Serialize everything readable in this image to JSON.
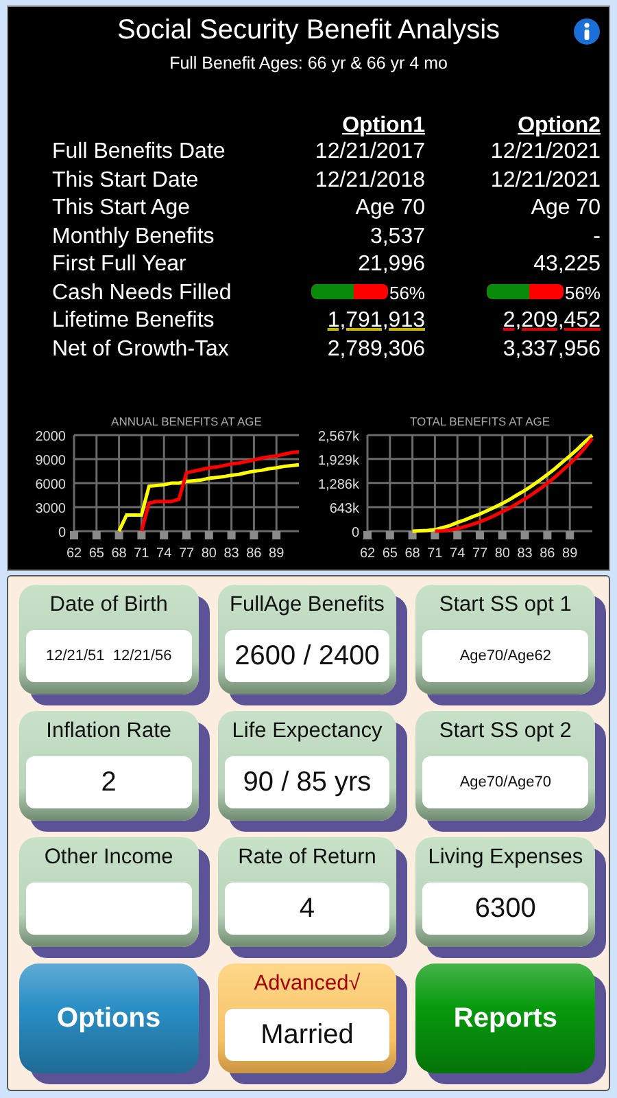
{
  "header": {
    "title": "Social Security Benefit Analysis",
    "subtitle": "Full Benefit Ages: 66 yr & 66 yr 4 mo"
  },
  "table": {
    "columns": [
      {
        "label": "Option1",
        "color": "#c8b400"
      },
      {
        "label": "Option2",
        "color": "#e00000"
      }
    ],
    "rows": [
      {
        "kind": "text",
        "label": "Full Benefits Date",
        "values": [
          "12/21/2017",
          "12/21/2021"
        ]
      },
      {
        "kind": "text",
        "label": "This Start Date",
        "values": [
          "12/21/2018",
          "12/21/2021"
        ]
      },
      {
        "kind": "text",
        "label": "This Start Age",
        "values": [
          "Age 70",
          "Age 70"
        ]
      },
      {
        "kind": "text",
        "label": "Monthly Benefits",
        "values": [
          "3,537",
          "-"
        ]
      },
      {
        "kind": "text",
        "label": "First Full Year",
        "values": [
          "21,996",
          "43,225"
        ]
      },
      {
        "kind": "meter",
        "label": "Cash Needs Filled",
        "cells": [
          {
            "level": 0.56,
            "reading": "56%"
          },
          {
            "level": 0.56,
            "reading": "56%"
          }
        ]
      },
      {
        "kind": "underlined",
        "label": "Lifetime Benefits",
        "values": [
          "1,791,913",
          "2,209,452"
        ]
      },
      {
        "kind": "text",
        "label": "Net of Growth-Tax",
        "values": [
          "2,789,306",
          "3,337,956"
        ]
      }
    ]
  },
  "charts": [
    {
      "chart_data": {
        "type": "line",
        "title": "ANNUAL BENEFITS AT AGE",
        "x": [
          68,
          69,
          70,
          71,
          72,
          73,
          74,
          75,
          76,
          77,
          78,
          79,
          80,
          81,
          82,
          83,
          84,
          85,
          86,
          87,
          88,
          89,
          90,
          91,
          92
        ],
        "xlim": [
          62,
          92
        ],
        "ylim": [
          0,
          12000
        ],
        "xticks": [
          62,
          65,
          68,
          71,
          74,
          77,
          80,
          83,
          86,
          89
        ],
        "yticks": [
          0,
          3000,
          6000,
          9000
        ],
        "series": [
          {
            "color": "#ffff00",
            "values": [
              0,
              2000,
              2000,
              2000,
              5600,
              5700,
              5800,
              6000,
              6000,
              6200,
              6300,
              6400,
              6600,
              6700,
              6800,
              7000,
              7100,
              7300,
              7500,
              7600,
              7800,
              7900,
              8100,
              8200,
              8300
            ]
          },
          {
            "color": "#ff0000",
            "values": [
              null,
              null,
              null,
              0,
              3500,
              3700,
              3700,
              3700,
              4000,
              7300,
              7500,
              7700,
              7900,
              8000,
              8200,
              8400,
              8500,
              8700,
              8900,
              9100,
              9300,
              9400,
              9600,
              9800,
              9900
            ]
          }
        ],
        "grid": true
      },
      "cut_top_label": "2000"
    },
    {
      "chart_data": {
        "type": "line",
        "title": "TOTAL BENEFITS AT AGE",
        "x": [
          68,
          69,
          70,
          71,
          72,
          73,
          74,
          75,
          76,
          77,
          78,
          79,
          80,
          81,
          82,
          83,
          84,
          85,
          86,
          87,
          88,
          89,
          90,
          91,
          92
        ],
        "xlim": [
          62,
          92
        ],
        "ylim": [
          0,
          2567
        ],
        "xticks": [
          62,
          65,
          68,
          71,
          74,
          77,
          80,
          83,
          86,
          89
        ],
        "yticks": [
          0,
          {
            "value": 643,
            "label": "643k"
          },
          {
            "value": 1286,
            "label": "1,286k"
          },
          {
            "value": 1929,
            "label": "1,929k"
          },
          {
            "value": 2567,
            "label": "2,567k"
          }
        ],
        "series": [
          {
            "color": "#ffff00",
            "values": [
              0,
              10,
              20,
              40,
              90,
              150,
              230,
              300,
              380,
              460,
              550,
              640,
              740,
              850,
              970,
              1090,
              1220,
              1360,
              1510,
              1670,
              1840,
              2010,
              2190,
              2380,
              2560
            ]
          },
          {
            "color": "#ff0000",
            "values": [
              null,
              null,
              null,
              0,
              10,
              30,
              70,
              120,
              180,
              250,
              330,
              420,
              520,
              620,
              740,
              860,
              990,
              1130,
              1280,
              1440,
              1620,
              1800,
              2000,
              2220,
              2480
            ]
          }
        ],
        "grid": true
      }
    }
  ],
  "inputs": [
    {
      "kind": "compact",
      "label": "Date of Birth",
      "value": "12/21/51  12/21/56"
    },
    {
      "kind": "plain",
      "label": "FullAge Benefits",
      "value": "2600 / 2400"
    },
    {
      "kind": "compact",
      "label": "Start SS opt 1",
      "value": "Age70/Age62"
    },
    {
      "kind": "plain",
      "label": "Inflation Rate",
      "value": "2"
    },
    {
      "kind": "plain",
      "label": "Life Expectancy",
      "value": "90 / 85 yrs"
    },
    {
      "kind": "compact",
      "label": "Start SS opt 2",
      "value": "Age70/Age70"
    },
    {
      "kind": "plain",
      "label": "Other Income"
    },
    {
      "kind": "plain",
      "label": "Rate of Return",
      "value": "4"
    },
    {
      "kind": "plain",
      "label": "Living Expenses",
      "value": "6300"
    }
  ],
  "bottom": [
    {
      "kind": "button",
      "label": "Options",
      "color": "#2a8fc6"
    },
    {
      "kind": "choice",
      "label": "Advanced√",
      "value": "Married"
    },
    {
      "kind": "button",
      "label": "Reports",
      "color": "#079a0d"
    }
  ]
}
